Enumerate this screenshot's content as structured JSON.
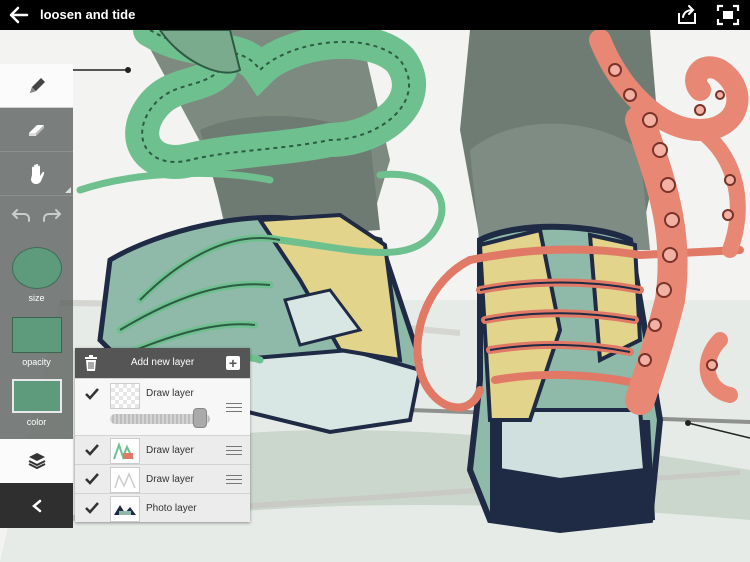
{
  "app": {
    "title": "loosen and tide"
  },
  "icons": {
    "back": "arrow-left-icon",
    "share": "share-icon",
    "fullscreen": "fullscreen-icon",
    "brush": "pencil-icon",
    "eraser": "eraser-icon",
    "hand": "hand-icon",
    "undo": "undo-icon",
    "redo": "redo-icon",
    "layers": "layers-icon",
    "collapse": "chevron-left-icon",
    "trash": "trash-icon",
    "add": "plus-icon",
    "check": "checkmark-icon",
    "drag": "drag-handle-icon"
  },
  "toolbar": {
    "size_label": "size",
    "opacity_label": "opacity",
    "color_label": "color",
    "current_color": "#5d9b7c"
  },
  "layers_panel": {
    "header_label": "Add new layer",
    "layers": [
      {
        "name": "Draw layer",
        "visible": true,
        "selected": true,
        "opacity": 0.9
      },
      {
        "name": "Draw layer",
        "visible": true,
        "selected": false
      },
      {
        "name": "Draw layer",
        "visible": true,
        "selected": false
      },
      {
        "name": "Photo layer",
        "visible": true,
        "selected": false
      }
    ]
  },
  "colors": {
    "topbar": "#000000",
    "panel_header": "#555555",
    "toolbar_bg": "#5f6462",
    "shoe_teal": "#8fb9a9",
    "lace_green": "#6fc08f",
    "lace_coral": "#e07a66",
    "octopus": "#e88874",
    "outline_navy": "#1f2a44"
  }
}
